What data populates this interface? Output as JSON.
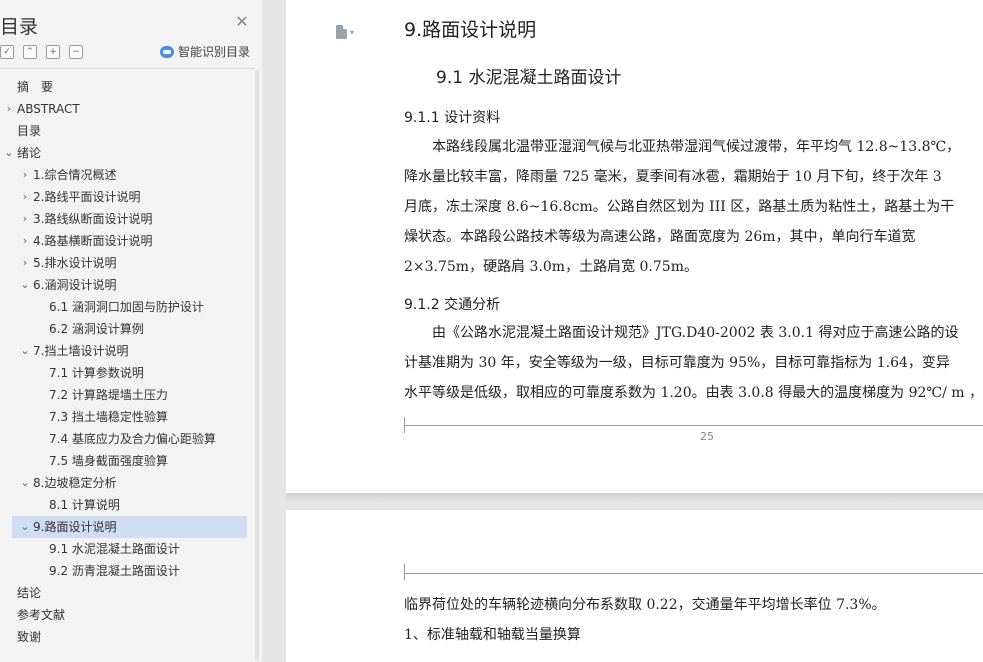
{
  "sidebar": {
    "title": "目录",
    "close_icon": "close-icon",
    "tools": [
      "expand-all-icon",
      "collapse-all-icon",
      "add-icon",
      "remove-icon"
    ],
    "smart_label": "智能识别目录",
    "items": [
      {
        "label": "摘　要",
        "level": 1,
        "chevron": ""
      },
      {
        "label": "ABSTRACT",
        "level": 1,
        "chevron": "right"
      },
      {
        "label": "目录",
        "level": 1,
        "chevron": ""
      },
      {
        "label": "绪论",
        "level": 1,
        "chevron": "down"
      },
      {
        "label": "1.综合情况概述",
        "level": 2,
        "chevron": "right"
      },
      {
        "label": "2.路线平面设计说明",
        "level": 2,
        "chevron": "right"
      },
      {
        "label": "3.路线纵断面设计说明",
        "level": 2,
        "chevron": "right"
      },
      {
        "label": "4.路基横断面设计说明",
        "level": 2,
        "chevron": "right"
      },
      {
        "label": "5.排水设计说明",
        "level": 2,
        "chevron": "right"
      },
      {
        "label": "6.涵洞设计说明",
        "level": 2,
        "chevron": "down"
      },
      {
        "label": "6.1 涵洞洞口加固与防护设计",
        "level": 3,
        "chevron": ""
      },
      {
        "label": "6.2 涵洞设计算例",
        "level": 3,
        "chevron": ""
      },
      {
        "label": "7.挡土墙设计说明",
        "level": 2,
        "chevron": "down"
      },
      {
        "label": "7.1 计算参数说明",
        "level": 3,
        "chevron": ""
      },
      {
        "label": "7.2 计算路堤墙土压力",
        "level": 3,
        "chevron": ""
      },
      {
        "label": "7.3 挡土墙稳定性验算",
        "level": 3,
        "chevron": ""
      },
      {
        "label": "7.4 基底应力及合力偏心距验算",
        "level": 3,
        "chevron": ""
      },
      {
        "label": "7.5 墙身截面强度验算",
        "level": 3,
        "chevron": ""
      },
      {
        "label": "8.边坡稳定分析",
        "level": 2,
        "chevron": "down"
      },
      {
        "label": "8.1 计算说明",
        "level": 3,
        "chevron": ""
      },
      {
        "label": "9.路面设计说明",
        "level": 2,
        "chevron": "down",
        "active": true
      },
      {
        "label": "9.1 水泥混凝土路面设计",
        "level": 3,
        "chevron": ""
      },
      {
        "label": "9.2 沥青混凝土路面设计",
        "level": 3,
        "chevron": ""
      },
      {
        "label": "结论",
        "level": 1,
        "chevron": ""
      },
      {
        "label": "参考文献",
        "level": 1,
        "chevron": ""
      },
      {
        "label": "致谢",
        "level": 1,
        "chevron": ""
      }
    ]
  },
  "document": {
    "page1": {
      "h1": "9.路面设计说明",
      "h2": "9.1 水泥混凝土路面设计",
      "s1_heading": "9.1.1 设计资料",
      "s1_lines": [
        "　　本路线段属北温带亚湿润气候与北亚热带湿润气候过渡带，年平均气 12.8~13.8℃，",
        "降水量比较丰富，降雨量 725 毫米，夏季间有冰雹，霜期始于 10 月下旬，终于次年 3",
        "月底，冻土深度 8.6~16.8cm。公路自然区划为 III 区，路基土质为粘性土，路基土为干",
        "燥状态。本路段公路技术等级为高速公路，路面宽度为 26m，其中，单向行车道宽",
        "2×3.75m，硬路肩 3.0m，土路肩宽 0.75m。"
      ],
      "s2_heading": "9.1.2 交通分析",
      "s2_lines": [
        "　　由《公路水泥混凝土路面设计规范》JTG.D40-2002 表 3.0.1 得对应于高速公路的设",
        "计基准期为 30 年，安全等级为一级，目标可靠度为 95%，目标可靠指标为 1.64，变异",
        "水平等级是低级，取相应的可靠度系数为 1.20。由表 3.0.8 得最大的温度梯度为 92℃/ m ，"
      ],
      "page_number": "25"
    },
    "page2": {
      "lines": [
        "临界荷位处的车辆轮迹横向分布系数取 0.22，交通量年平均增长率位 7.3%。",
        "1、标准轴载和轴载当量换算"
      ]
    }
  },
  "colors": {
    "sidebar_bg": "#f3f3f3",
    "active_item": "#cfdcf2",
    "accent": "#4a90e2"
  }
}
